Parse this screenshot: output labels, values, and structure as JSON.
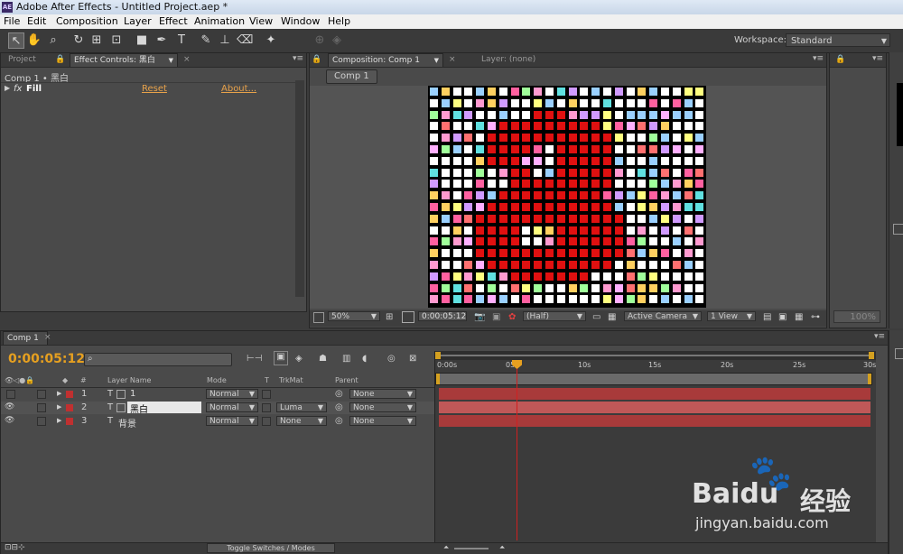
{
  "app": {
    "title": "Adobe After Effects - Untitled Project.aep *",
    "logo": "AE"
  },
  "menu": [
    "File",
    "Edit",
    "Composition",
    "Layer",
    "Effect",
    "Animation",
    "View",
    "Window",
    "Help"
  ],
  "toolbar": {
    "workspace_label": "Workspace:",
    "workspace_value": "Standard"
  },
  "left_panel": {
    "tab_project": "Project",
    "tab_effect_controls": "Effect Controls: 黑白",
    "breadcrumb": "Comp 1 • 黑白",
    "effect": {
      "fx": "fx",
      "name": "Fill",
      "reset": "Reset",
      "about": "About..."
    }
  },
  "comp_panel": {
    "tab_comp": "Composition: Comp 1",
    "tab_layer": "Layer: (none)",
    "comp_button": "Comp 1",
    "zoom": "50%",
    "timecode": "0:00:05:12",
    "resolution": "(Half)",
    "camera": "Active Camera",
    "view": "1 View"
  },
  "right_panel": {
    "zoom": "100%"
  },
  "timeline": {
    "tab": "Comp 1",
    "timecode": "0:00:05:12",
    "search_placeholder": "",
    "headers": {
      "layer_name": "Layer Name",
      "mode": "Mode",
      "t": "T",
      "trkmat": "TrkMat",
      "parent": "Parent",
      "num": "#"
    },
    "layers": [
      {
        "num": "1",
        "type": "T",
        "name": "1",
        "mode": "Normal",
        "trkmat": "",
        "parent": "None"
      },
      {
        "num": "2",
        "type": "T",
        "name": "黑白",
        "mode": "Normal",
        "trkmat": "Luma",
        "parent": "None"
      },
      {
        "num": "3",
        "type": "T",
        "name": "背景",
        "mode": "Normal",
        "trkmat": "None",
        "parent": "None"
      }
    ],
    "ruler": [
      "0:00s",
      "05s",
      "10s",
      "15s",
      "20s",
      "25s",
      "30s"
    ],
    "toggle_label": "Toggle Switches / Modes"
  },
  "watermark": {
    "brand": "Baidu",
    "cn": "经验",
    "url": "jingyan.baidu.com"
  },
  "colors": {
    "accent_orange": "#e8a24a",
    "timecode": "#e6a020",
    "track_red": "#a83a3a",
    "playhead": "#d02020",
    "digit_red": "#e01010"
  }
}
